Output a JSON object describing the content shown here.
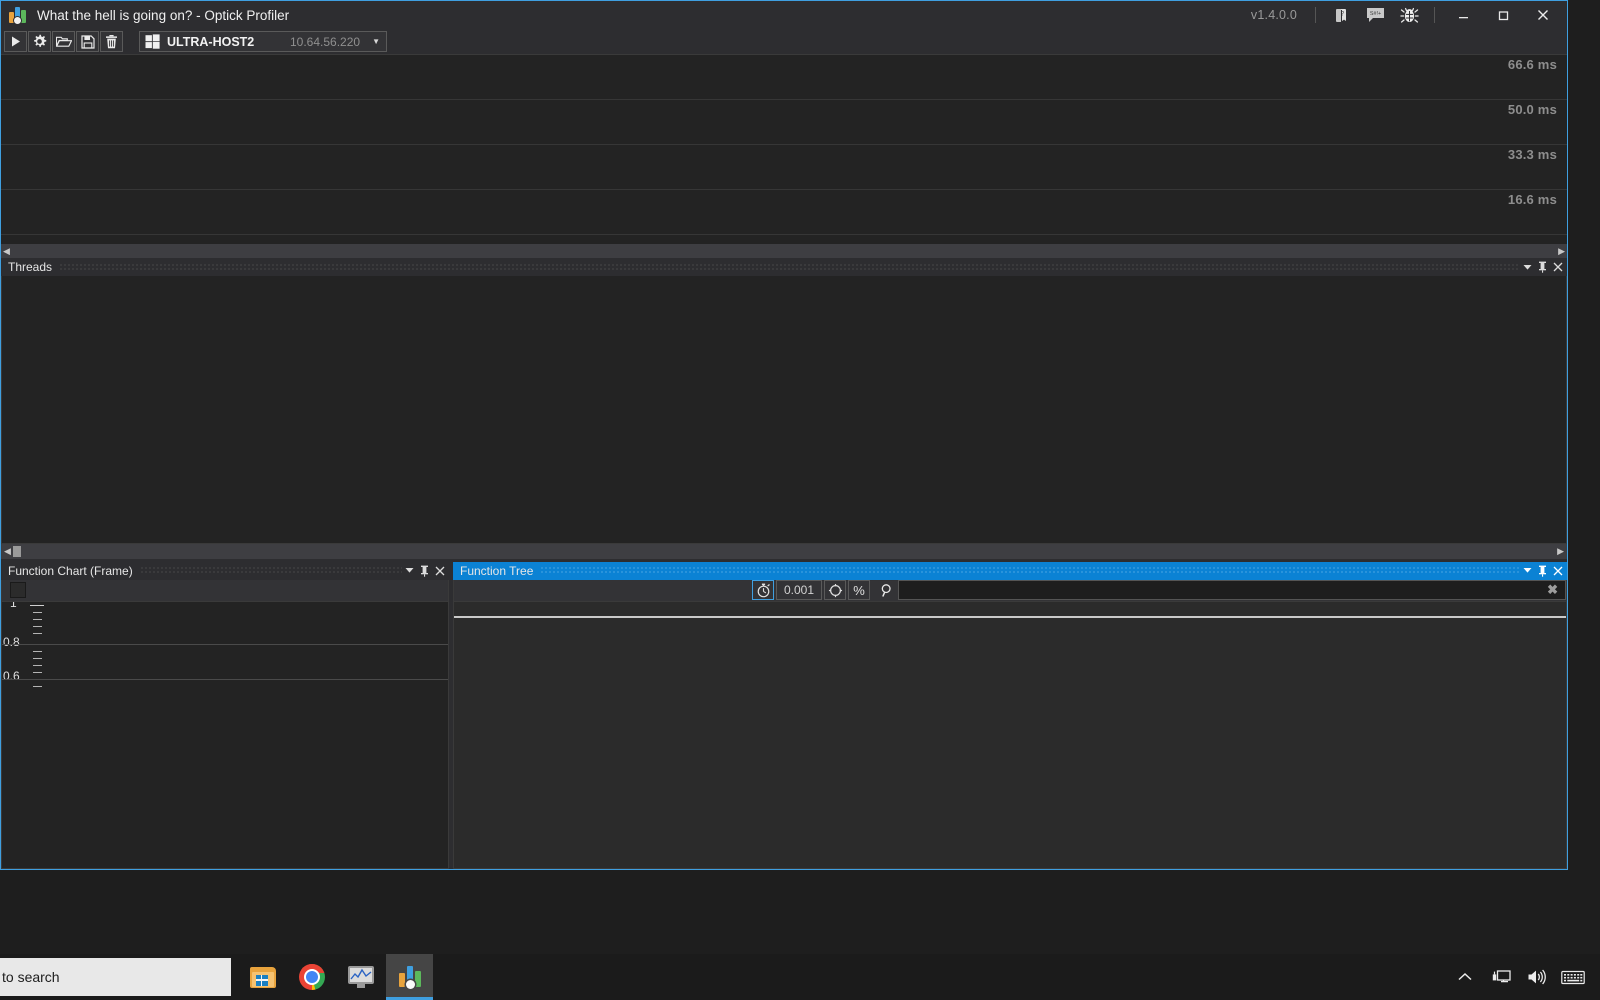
{
  "window": {
    "title": "What the hell is going on? - Optick Profiler",
    "version": "v1.4.0.0",
    "logo_icon": "optick-logo-icon",
    "help_icon": "book-help-icon",
    "feedback_icon": "feedback-comment-icon",
    "bug_icon": "bug-icon",
    "minimize_icon": "minimize-icon",
    "maximize_icon": "maximize-icon",
    "close_icon": "close-icon",
    "accent": "#3f9fe0"
  },
  "toolbar": {
    "start_label": "start-capture",
    "settings_label": "settings",
    "open_label": "open-capture",
    "save_label": "save-capture",
    "clear_label": "clear-capture",
    "host": {
      "platform_icon": "windows-icon",
      "name": "ULTRA-HOST2",
      "address": "10.64.56.220",
      "arrow": "▼"
    }
  },
  "timeline": {
    "rows": [
      {
        "label": "66.6 ms"
      },
      {
        "label": "50.0 ms"
      },
      {
        "label": "33.3 ms"
      },
      {
        "label": "16.6 ms"
      }
    ],
    "scroll_left_arrow": "◀",
    "scroll_right_arrow": "▶"
  },
  "threads_panel": {
    "title": "Threads",
    "collapse_icon": "chevron-down-icon",
    "pin_icon": "pin-icon",
    "close_icon": "close-icon",
    "scroll_left_arrow": "◀",
    "scroll_right_arrow": "▶"
  },
  "function_chart_panel": {
    "title": "Function Chart (Frame)",
    "collapse_icon": "chevron-down-icon",
    "pin_icon": "pin-icon",
    "close_icon": "close-icon",
    "checkbox_checked": false,
    "axis_labels": [
      "1",
      "0.8",
      "0.6"
    ]
  },
  "function_tree_panel": {
    "title": "Function Tree",
    "active": true,
    "collapse_icon": "chevron-down-icon",
    "pin_icon": "pin-icon",
    "close_icon": "close-icon",
    "toolbar": {
      "timer_icon": "stopwatch-icon",
      "threshold_value": "0.001",
      "target_icon": "crosshair-target-icon",
      "percent_label": "%",
      "search_icon": "search-icon",
      "search_value": "",
      "search_placeholder": "",
      "clear_icon": "clear-x-icon"
    }
  },
  "taskbar": {
    "search_text": "to search",
    "items": [
      {
        "name": "file-explorer",
        "icon": "folder-icon",
        "active": false
      },
      {
        "name": "google-chrome",
        "icon": "chrome-icon",
        "active": false
      },
      {
        "name": "task-manager",
        "icon": "monitor-chart-icon",
        "active": false
      },
      {
        "name": "optick-profiler",
        "icon": "optick-icon",
        "active": true
      }
    ],
    "tray": [
      {
        "name": "show-hidden-icons",
        "icon": "chevron-up-icon"
      },
      {
        "name": "network",
        "icon": "network-monitor-icon"
      },
      {
        "name": "volume",
        "icon": "speaker-icon"
      },
      {
        "name": "touch-keyboard",
        "icon": "keyboard-icon"
      }
    ]
  }
}
